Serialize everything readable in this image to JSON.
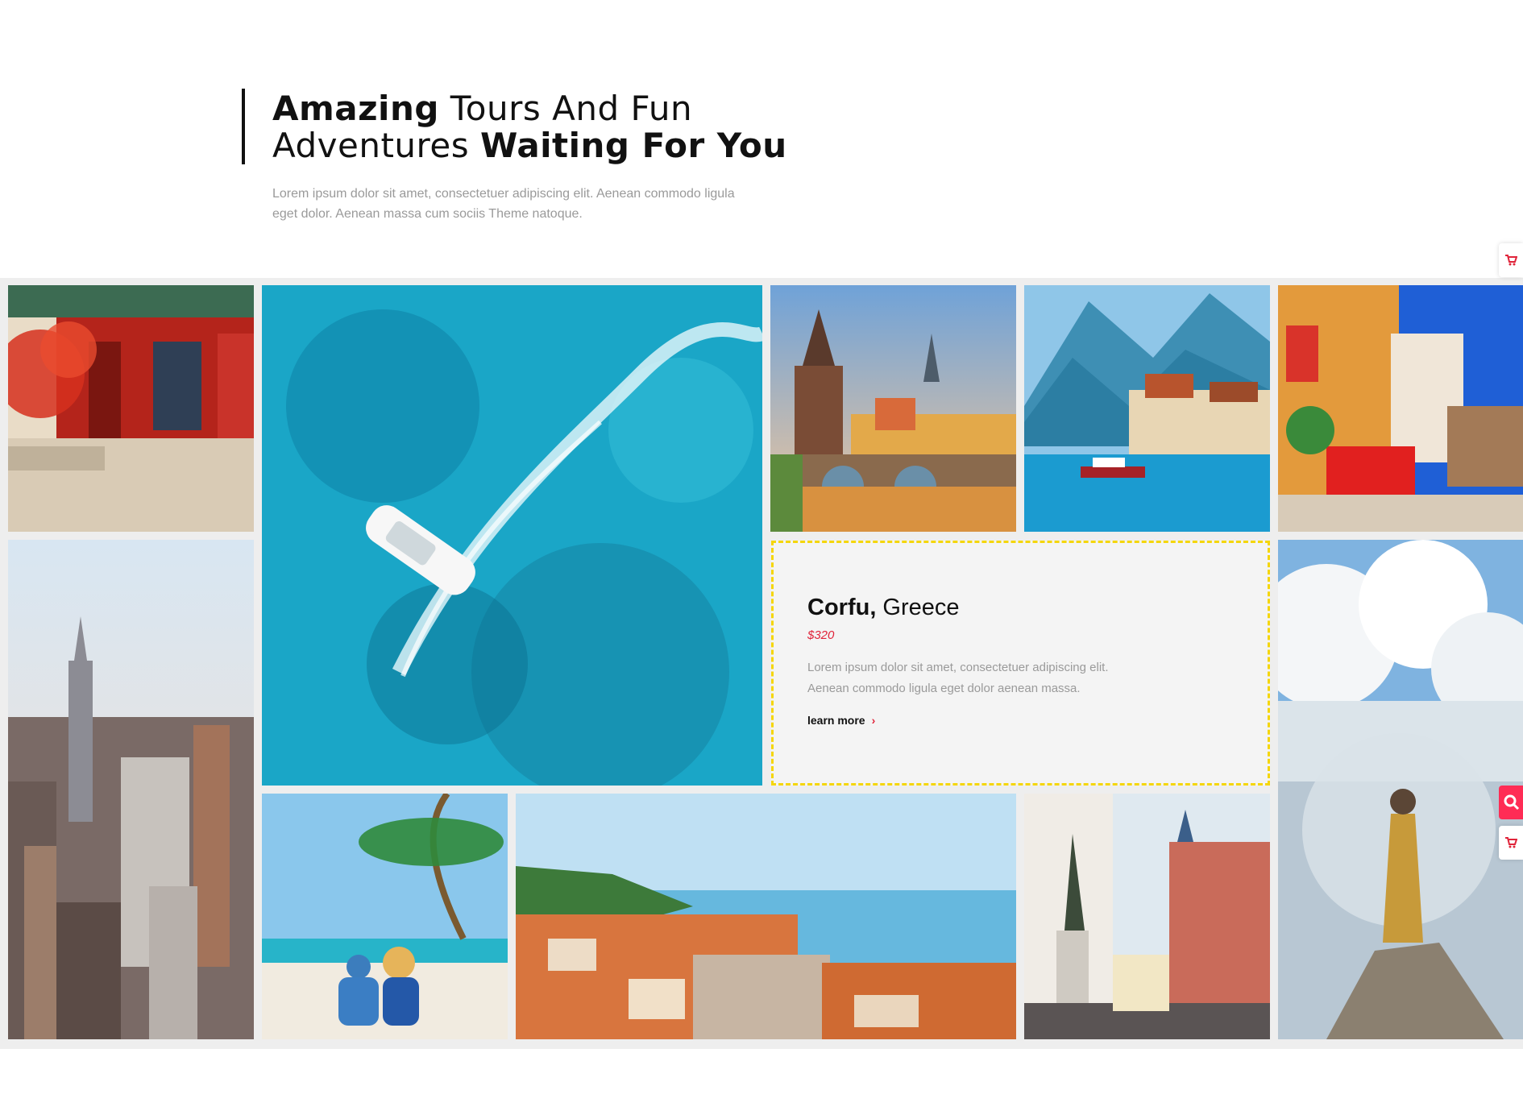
{
  "intro": {
    "heading_bold_1": "Amazing",
    "heading_light_1": " Tours And Fun",
    "heading_light_2": "Adventures ",
    "heading_bold_2": "Waiting For You",
    "description": "Lorem ipsum dolor sit amet, consectetuer adipiscing elit. Aenean commodo ligula eget dolor. Aenean massa cum sociis Theme natoque."
  },
  "gallery": {
    "tiles": [
      {
        "name": "temple-photo",
        "subject": "Chinese temple"
      },
      {
        "name": "boat-photo",
        "subject": "Speedboat on turquoise sea"
      },
      {
        "name": "prague-photo",
        "subject": "Prague bridge"
      },
      {
        "name": "lake-town-photo",
        "subject": "Lakeside town with mountains"
      },
      {
        "name": "greek-house-photo",
        "subject": "Colorful Greek house"
      },
      {
        "name": "new-york-photo",
        "subject": "New York skyline"
      },
      {
        "name": "mountain-hiker-photo",
        "subject": "Hiker on mountain"
      },
      {
        "name": "beach-couple-photo",
        "subject": "Couple on beach"
      },
      {
        "name": "coastal-town-photo",
        "subject": "Coastal town"
      },
      {
        "name": "madrid-square-photo",
        "subject": "City square with statue"
      }
    ],
    "featured": {
      "title_bold": "Corfu,",
      "title_light": " Greece",
      "price": "$320",
      "description": "Lorem ipsum dolor sit amet, consectetuer adipiscing elit. Aenean commodo ligula eget dolor aenean massa.",
      "link_label": "learn more",
      "link_icon": "chevron-right-icon"
    }
  },
  "side_widgets": [
    {
      "icon": "cart-icon"
    },
    {
      "icon": "search-icon"
    },
    {
      "icon": "cart-icon"
    }
  ],
  "colors": {
    "accent": "#e0243a",
    "card_border": "#f5d60a",
    "side_pink": "#ff2c55"
  }
}
